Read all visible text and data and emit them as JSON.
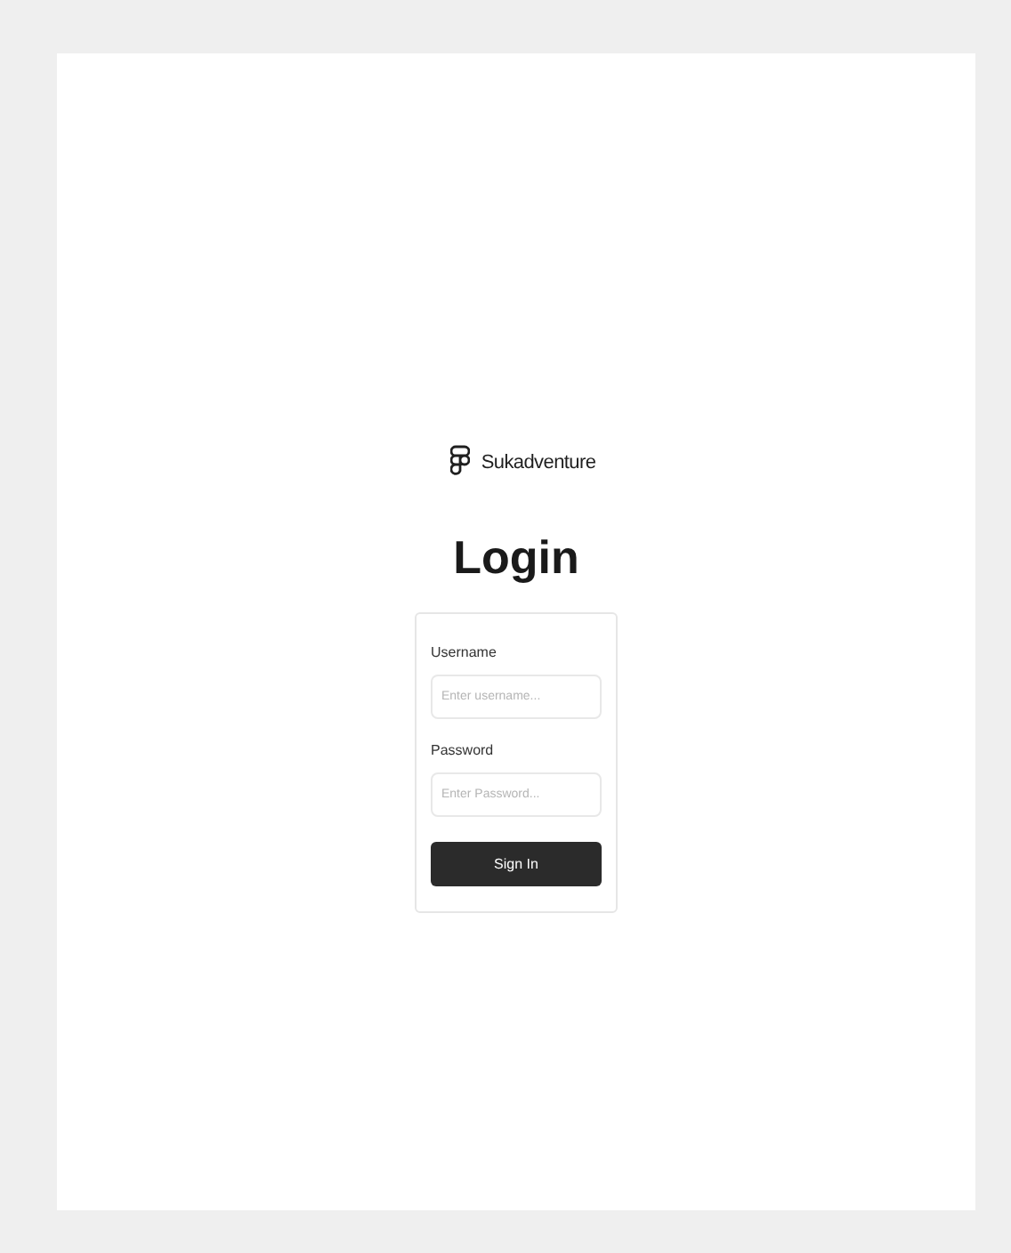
{
  "brand": {
    "name": "Sukadventure"
  },
  "title": "Login",
  "form": {
    "fields": [
      {
        "label": "Username",
        "placeholder": "Enter username..."
      },
      {
        "label": "Password",
        "placeholder": "Enter Password..."
      }
    ],
    "submit": "Sign In"
  }
}
